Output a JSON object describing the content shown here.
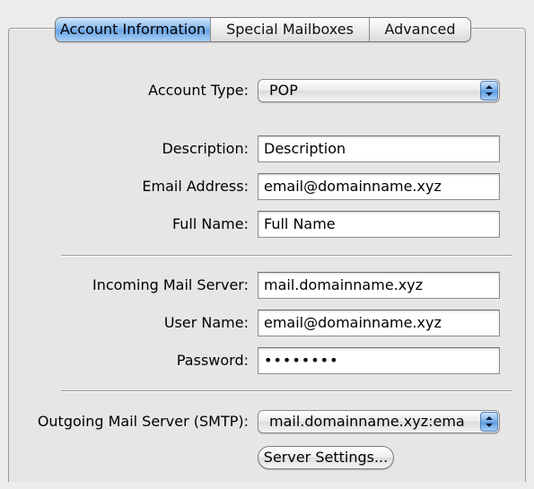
{
  "tabs": [
    {
      "label": "Account Information",
      "active": true
    },
    {
      "label": "Special Mailboxes",
      "active": false
    },
    {
      "label": "Advanced",
      "active": false
    }
  ],
  "account_type": {
    "label": "Account Type:",
    "value": "POP"
  },
  "description": {
    "label": "Description:",
    "value": "Description"
  },
  "email_address": {
    "label": "Email Address:",
    "value": "email@domainname.xyz"
  },
  "full_name": {
    "label": "Full Name:",
    "value": "Full Name"
  },
  "incoming_server": {
    "label": "Incoming Mail Server:",
    "value": "mail.domainname.xyz"
  },
  "user_name": {
    "label": "User Name:",
    "value": "email@domainname.xyz"
  },
  "password": {
    "label": "Password:",
    "value": "••••••••"
  },
  "outgoing_server": {
    "label": "Outgoing Mail Server (SMTP):",
    "value": "mail.domainname.xyz:ema"
  },
  "server_settings_button": "Server Settings...",
  "colors": {
    "active_tab": "#86b8ec",
    "popup_arrow": "#5e9ce0",
    "panel_bg": "#e6e6e6"
  }
}
